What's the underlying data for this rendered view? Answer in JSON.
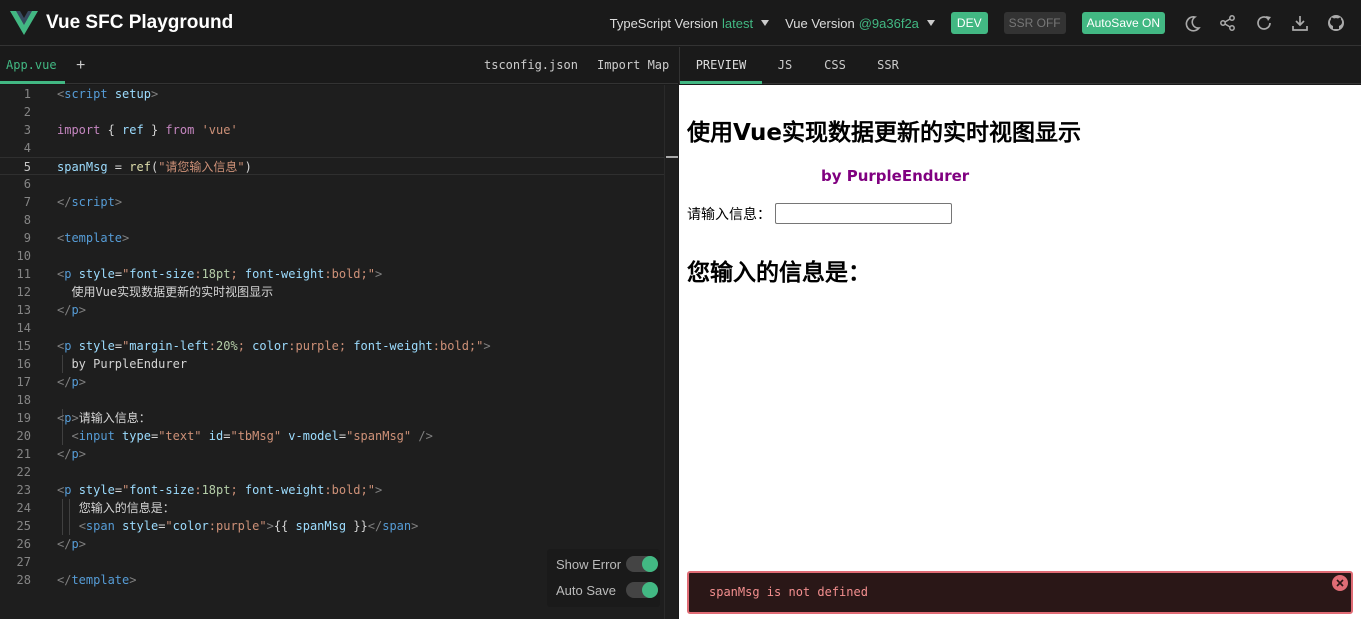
{
  "header": {
    "title": "Vue SFC Playground",
    "ts_label": "TypeScript Version",
    "ts_value": "latest",
    "vue_label": "Vue Version",
    "vue_value": "@9a36f2a",
    "dev_label": "DEV",
    "ssr_label": "SSR OFF",
    "autosave_label": "AutoSave ON",
    "icons": [
      "moon-icon",
      "share-icon",
      "reload-icon",
      "download-icon",
      "github-icon"
    ]
  },
  "editor": {
    "active_file": "App.vue",
    "add_label": "+",
    "tsconfig_label": "tsconfig.json",
    "import_map_label": "Import Map",
    "line_numbers": [
      "1",
      "2",
      "3",
      "4",
      "5",
      "6",
      "7",
      "8",
      "9",
      "10",
      "11",
      "12",
      "13",
      "14",
      "15",
      "16",
      "17",
      "18",
      "19",
      "20",
      "21",
      "22",
      "23",
      "24",
      "25",
      "26",
      "27",
      "28"
    ],
    "current_line": 5
  },
  "toggles": {
    "show_error": "Show Error",
    "auto_save": "Auto Save"
  },
  "output": {
    "tabs": [
      "PREVIEW",
      "JS",
      "CSS",
      "SSR"
    ],
    "active_tab": "PREVIEW"
  },
  "preview": {
    "heading": "使用Vue实现数据更新的实时视图显示",
    "author": "by PurpleEndurer",
    "prompt": "请输入信息：",
    "result": "您输入的信息是：",
    "error": "spanMsg is not defined"
  },
  "colors": {
    "accent": "#42b883",
    "error": "#e06c75",
    "purple": "#800080"
  }
}
